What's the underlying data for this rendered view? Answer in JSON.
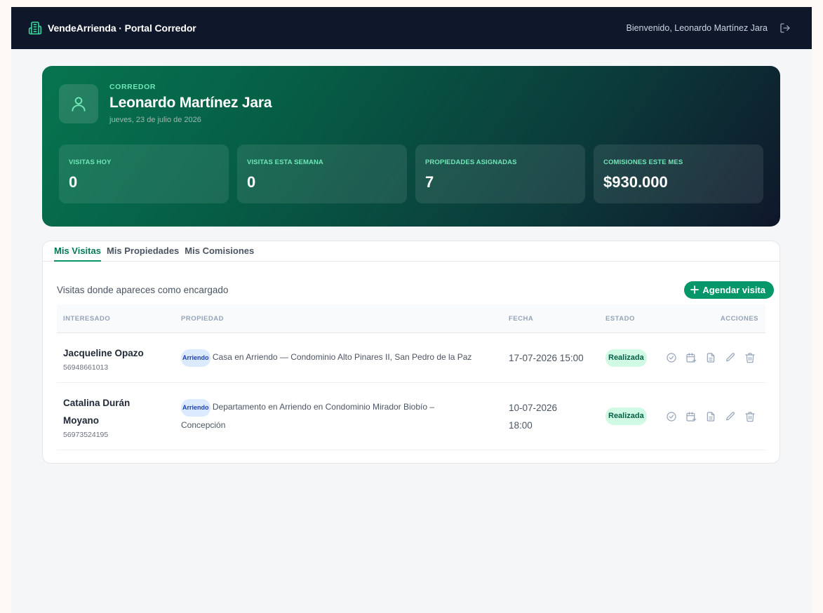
{
  "navbar": {
    "brand_icon": "building-icon",
    "title": "VendeArrienda · Portal Corredor",
    "welcome": "Bienvenido, Leonardo Martínez Jara",
    "logout_icon": "logout-icon"
  },
  "hero": {
    "avatar_icon": "user-icon",
    "role": "CORREDOR",
    "name": "Leonardo Martínez Jara",
    "date": "jueves, 23 de julio de 2026",
    "stats": [
      {
        "label": "VISITAS HOY",
        "value": "0"
      },
      {
        "label": "VISITAS ESTA SEMANA",
        "value": "0"
      },
      {
        "label": "PROPIEDADES ASIGNADAS",
        "value": "7"
      },
      {
        "label": "COMISIONES ESTE MES",
        "value": "$930.000"
      }
    ]
  },
  "tabs": [
    {
      "label": "Mis Visitas",
      "active": true
    },
    {
      "label": "Mis Propiedades",
      "active": false
    },
    {
      "label": "Mis Comisiones",
      "active": false
    }
  ],
  "visits": {
    "subtitle": "Visitas donde apareces como encargado",
    "add_button": "Agendar visita",
    "columns": [
      "INTERESADO",
      "PROPIEDAD",
      "FECHA",
      "ESTADO",
      "ACCIONES"
    ],
    "rows": [
      {
        "name": "Jacqueline Opazo",
        "phone": "56948661013",
        "tag": "Arriendo",
        "property": "Casa en Arriendo — Condominio Alto Pinares II, San Pedro de la Paz",
        "date": "17-07-2026 15:00",
        "status": "Realizada"
      },
      {
        "name": "Catalina Durán Moyano",
        "phone": "56973524195",
        "tag": "Arriendo",
        "property": "Departamento en Arriendo en Condominio Mirador Biobío – Concepción",
        "date": "10-07-2026 18:00",
        "status": "Realizada"
      }
    ],
    "action_icons": [
      "check-circle-icon",
      "calendar-plus-icon",
      "document-icon",
      "pencil-icon",
      "trash-icon"
    ]
  },
  "colors": {
    "navbar_bg": "#0f172a",
    "accent": "#059669",
    "accent_light": "#6ee7b7",
    "tag_bg": "#dbeafe",
    "badge_bg": "#d1fae5"
  }
}
